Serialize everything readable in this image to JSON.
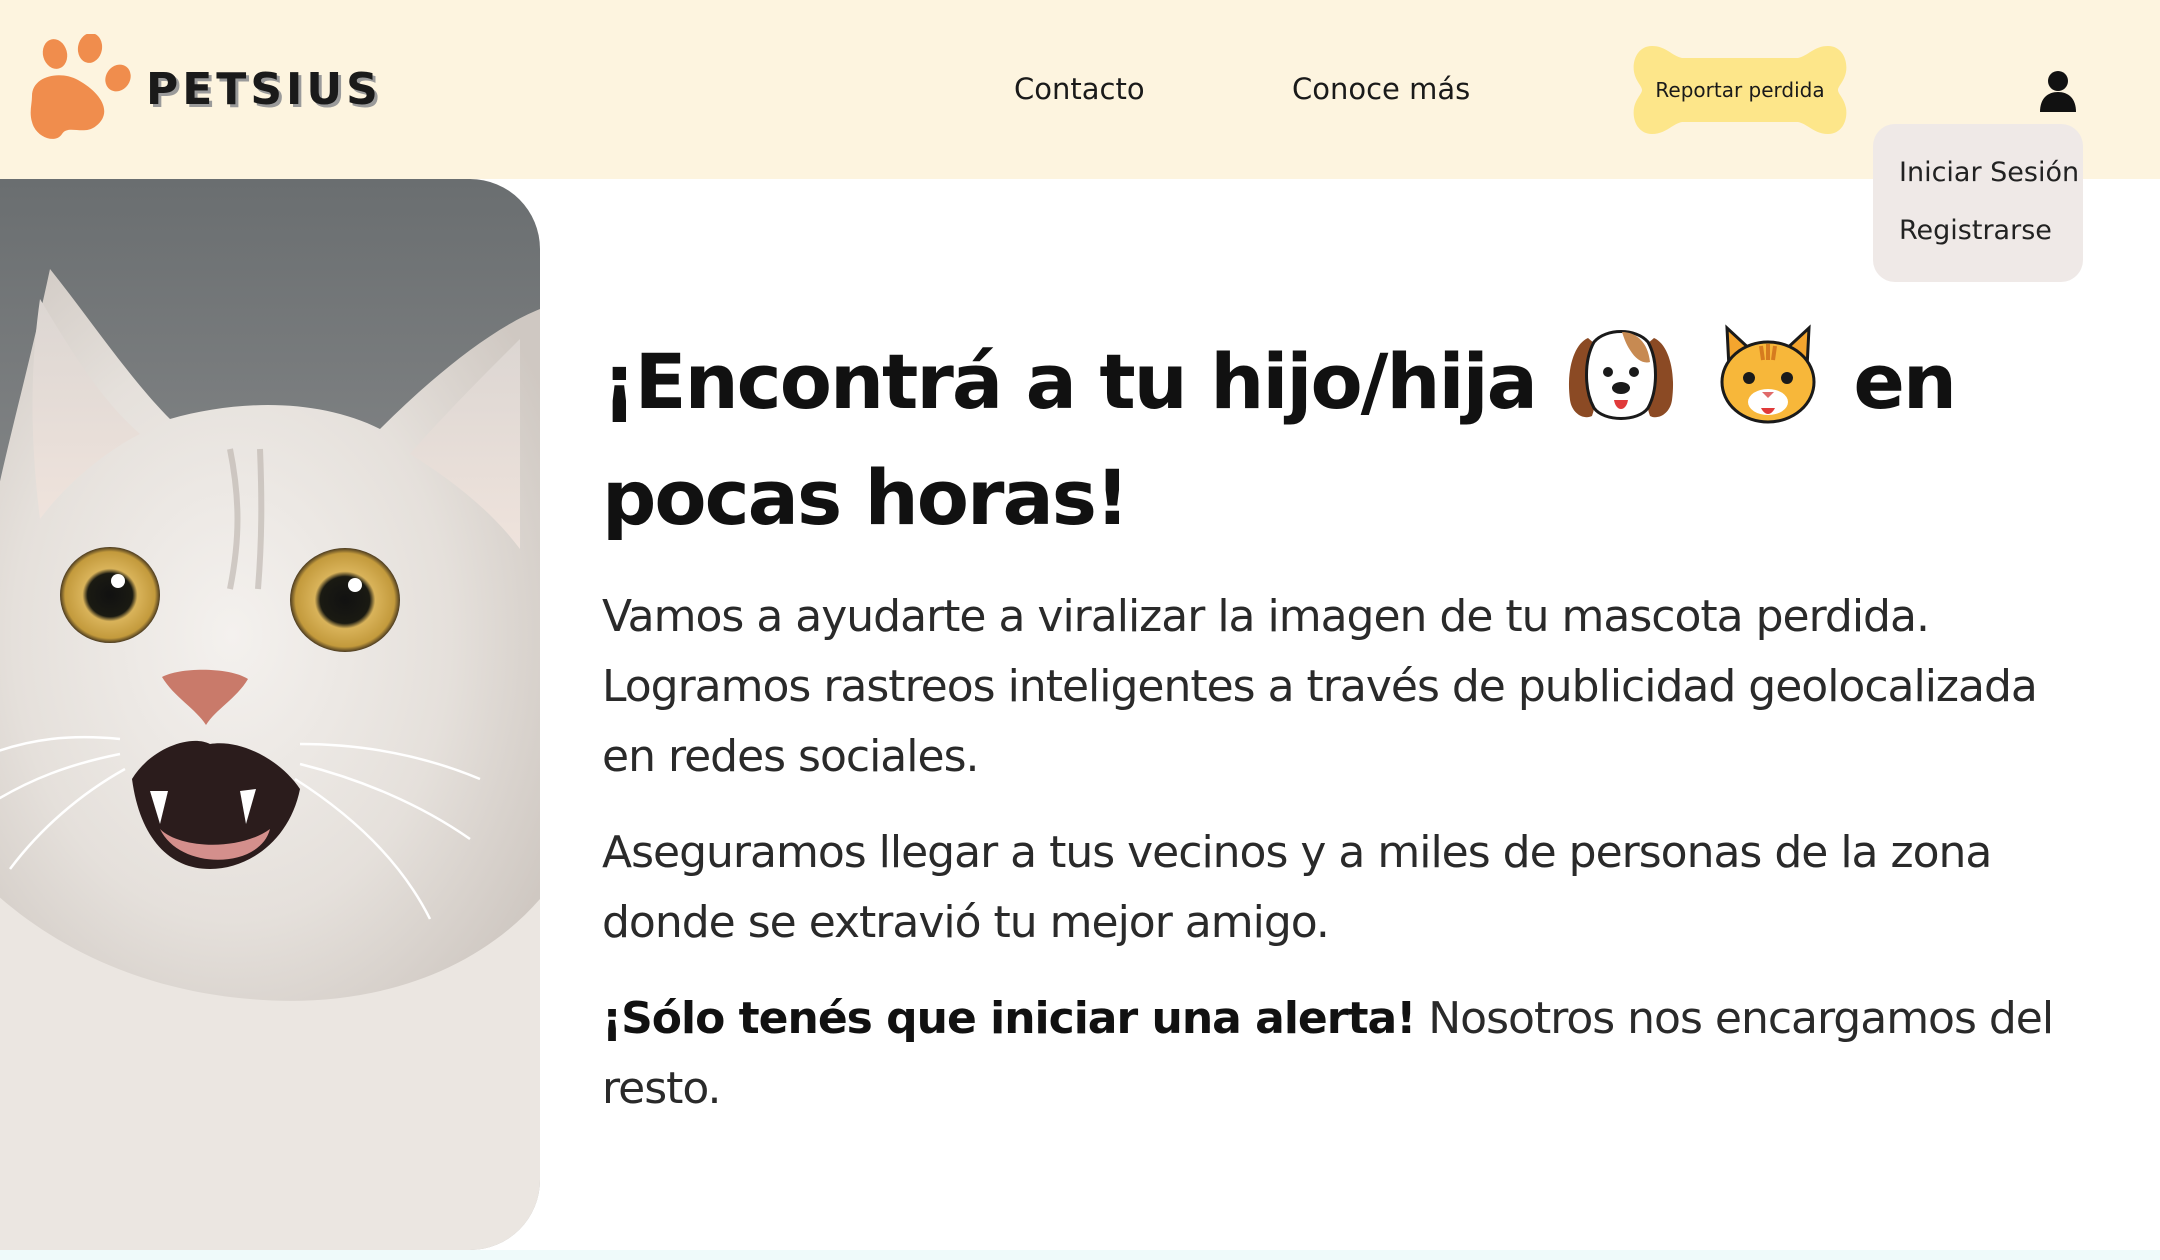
{
  "header": {
    "brand": "PETSIUS",
    "nav": {
      "contact": "Contacto",
      "more": "Conoce más"
    },
    "report_button": "Reportar perdida",
    "user_menu": {
      "login": "Iniciar Sesión",
      "register": "Registrarse"
    }
  },
  "hero": {
    "headline_part1": "¡Encontrá a tu hijo/hija",
    "headline_part2": "en pocas horas!",
    "emojis": [
      "dog-face-icon",
      "cat-face-icon"
    ],
    "paragraph1": "Vamos a ayudarte a viralizar la imagen de tu mascota perdida. Logramos rastreos inteligentes a través de publicidad geolocalizada en redes sociales.",
    "paragraph2": "Aseguramos llegar a tus vecinos y a miles de personas de la zona donde se extravió tu mejor amigo.",
    "paragraph3_bold": "¡Sólo tenés que iniciar una alerta!",
    "paragraph3_rest": " Nosotros nos encargamos del resto."
  },
  "colors": {
    "header_bg": "#fdf4df",
    "accent_orange": "#f08d4d",
    "button_yellow": "#fde68a",
    "menu_bg": "#efe9e7"
  }
}
